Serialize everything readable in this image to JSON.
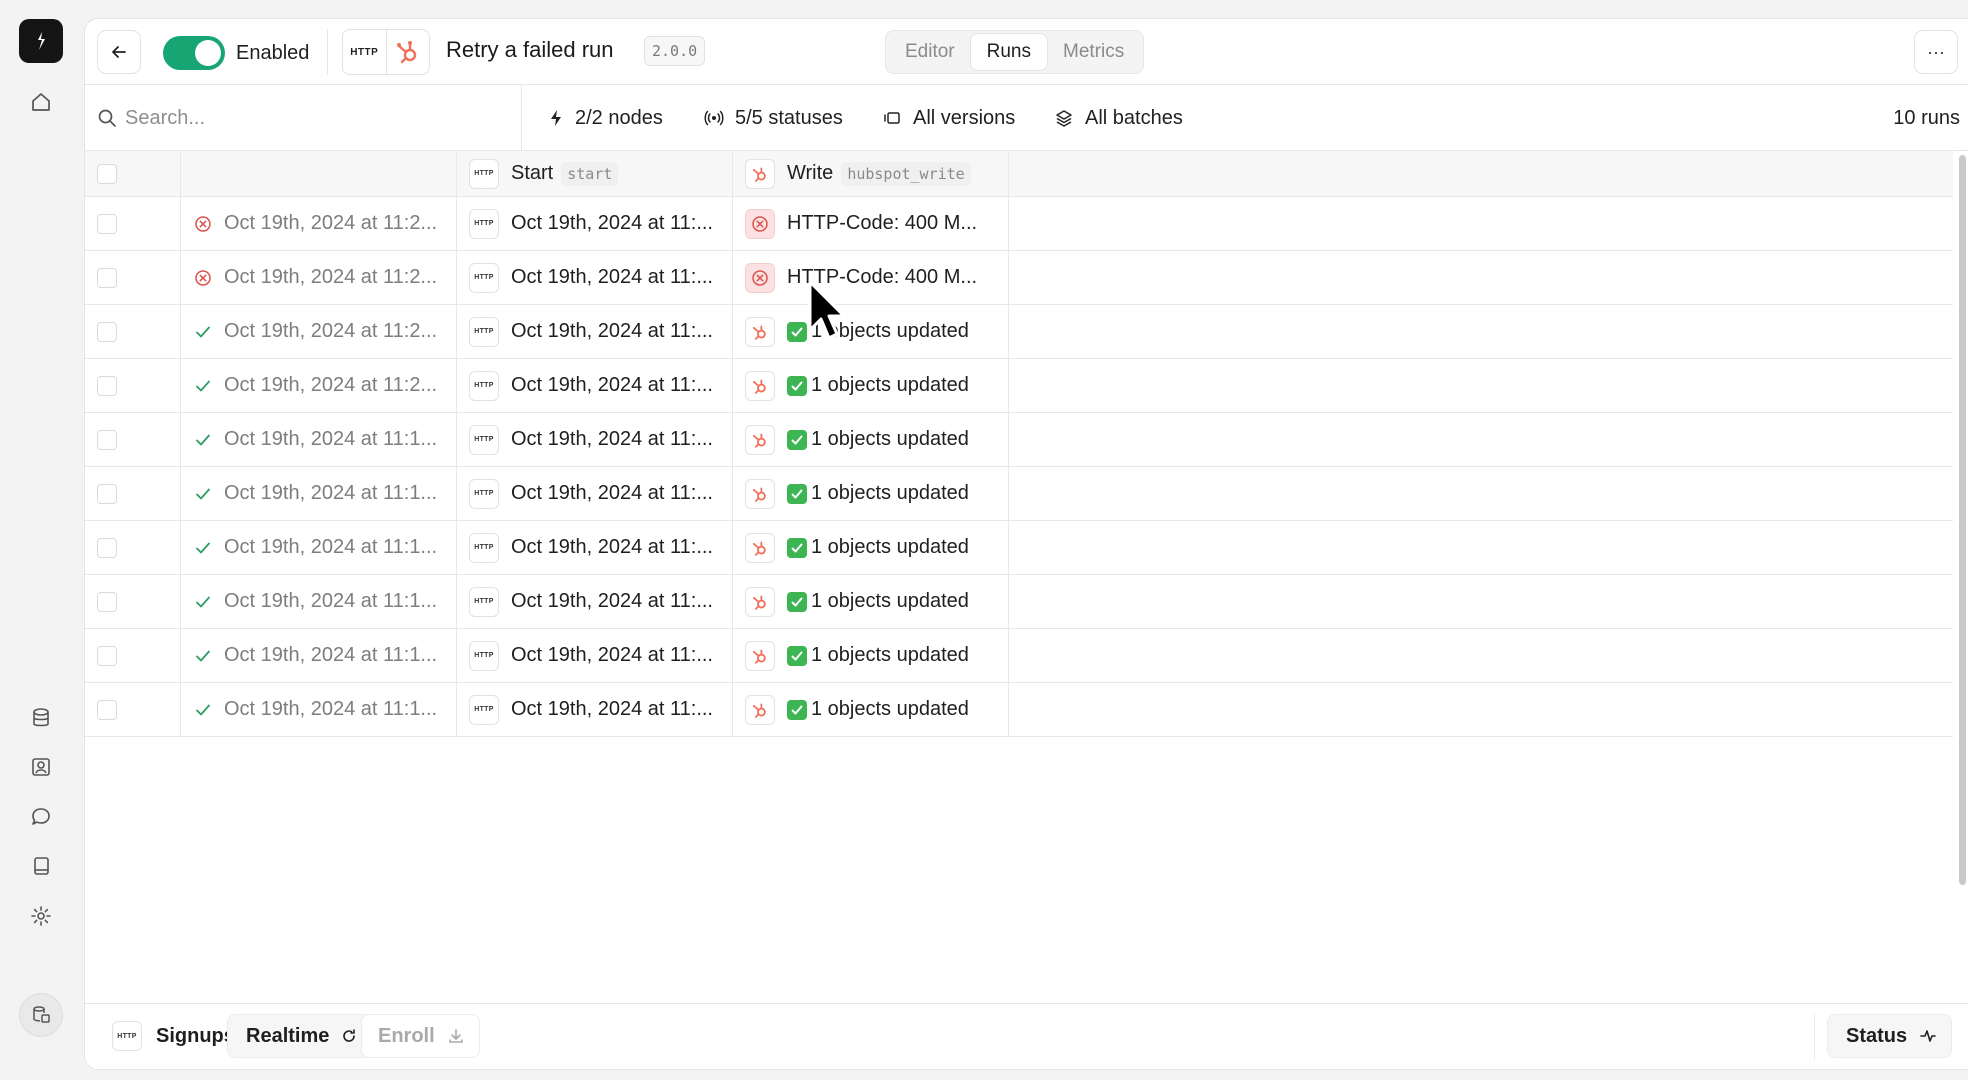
{
  "app": {
    "toggle_label": "Enabled",
    "title": "Retry a failed run",
    "version": "2.0.0",
    "http_label": "HTTP",
    "tabs": [
      {
        "label": "Editor",
        "active": false
      },
      {
        "label": "Runs",
        "active": true
      },
      {
        "label": "Metrics",
        "active": false
      }
    ],
    "more_label": "···"
  },
  "filters": {
    "search_placeholder": "Search...",
    "nodes": "2/2 nodes",
    "statuses": "5/5 statuses",
    "versions": "All versions",
    "batches": "All batches",
    "run_count": "10 runs"
  },
  "table": {
    "columns": {
      "start_label": "Start",
      "start_code": "start",
      "write_label": "Write",
      "write_code": "hubspot_write"
    },
    "rows": [
      {
        "status": "error",
        "time": "Oct 19th, 2024 at 11:2...",
        "start": "Oct 19th, 2024 at 11:...",
        "write_status": "error",
        "write": "HTTP-Code: 400 M..."
      },
      {
        "status": "error",
        "time": "Oct 19th, 2024 at 11:2...",
        "start": "Oct 19th, 2024 at 11:...",
        "write_status": "error",
        "write": "HTTP-Code: 400 M..."
      },
      {
        "status": "success",
        "time": "Oct 19th, 2024 at 11:2...",
        "start": "Oct 19th, 2024 at 11:...",
        "write_status": "success",
        "write": "1 objects updated"
      },
      {
        "status": "success",
        "time": "Oct 19th, 2024 at 11:2...",
        "start": "Oct 19th, 2024 at 11:...",
        "write_status": "success",
        "write": "1 objects updated"
      },
      {
        "status": "success",
        "time": "Oct 19th, 2024 at 11:1...",
        "start": "Oct 19th, 2024 at 11:...",
        "write_status": "success",
        "write": "1 objects updated"
      },
      {
        "status": "success",
        "time": "Oct 19th, 2024 at 11:1...",
        "start": "Oct 19th, 2024 at 11:...",
        "write_status": "success",
        "write": "1 objects updated"
      },
      {
        "status": "success",
        "time": "Oct 19th, 2024 at 11:1...",
        "start": "Oct 19th, 2024 at 11:...",
        "write_status": "success",
        "write": "1 objects updated"
      },
      {
        "status": "success",
        "time": "Oct 19th, 2024 at 11:1...",
        "start": "Oct 19th, 2024 at 11:...",
        "write_status": "success",
        "write": "1 objects updated"
      },
      {
        "status": "success",
        "time": "Oct 19th, 2024 at 11:1...",
        "start": "Oct 19th, 2024 at 11:...",
        "write_status": "success",
        "write": "1 objects updated"
      },
      {
        "status": "success",
        "time": "Oct 19th, 2024 at 11:1...",
        "start": "Oct 19th, 2024 at 11:...",
        "write_status": "success",
        "write": "1 objects updated"
      }
    ]
  },
  "footer": {
    "signups_label": "Signups",
    "realtime_label": "Realtime",
    "enroll_label": "Enroll",
    "status_label": "Status"
  },
  "colors": {
    "accent_green": "#17a673",
    "error_red": "#d9534f",
    "success_green": "#3db553",
    "hubspot_orange": "#f0705a"
  }
}
